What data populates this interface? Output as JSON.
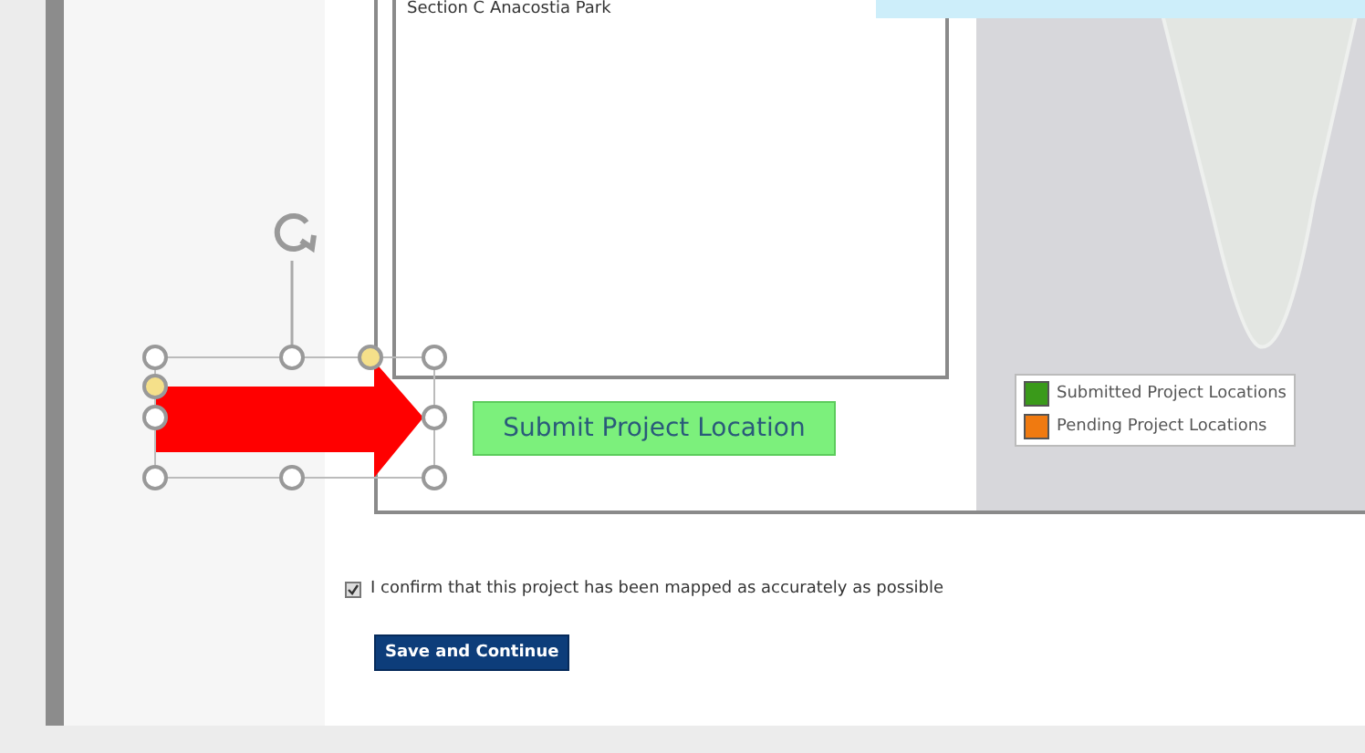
{
  "location_list": {
    "items": [
      {
        "label": "Section C Anacostia Park"
      }
    ]
  },
  "submit_button": "Submit Project Location",
  "legend": [
    {
      "label": "Submitted Project Locations",
      "color": "#3a9a1a"
    },
    {
      "label": "Pending Project Locations",
      "color": "#f07a10"
    }
  ],
  "confirm": {
    "label": "I confirm that this project has been mapped as accurately as possible",
    "checked": true
  },
  "save_button": "Save and Continue"
}
